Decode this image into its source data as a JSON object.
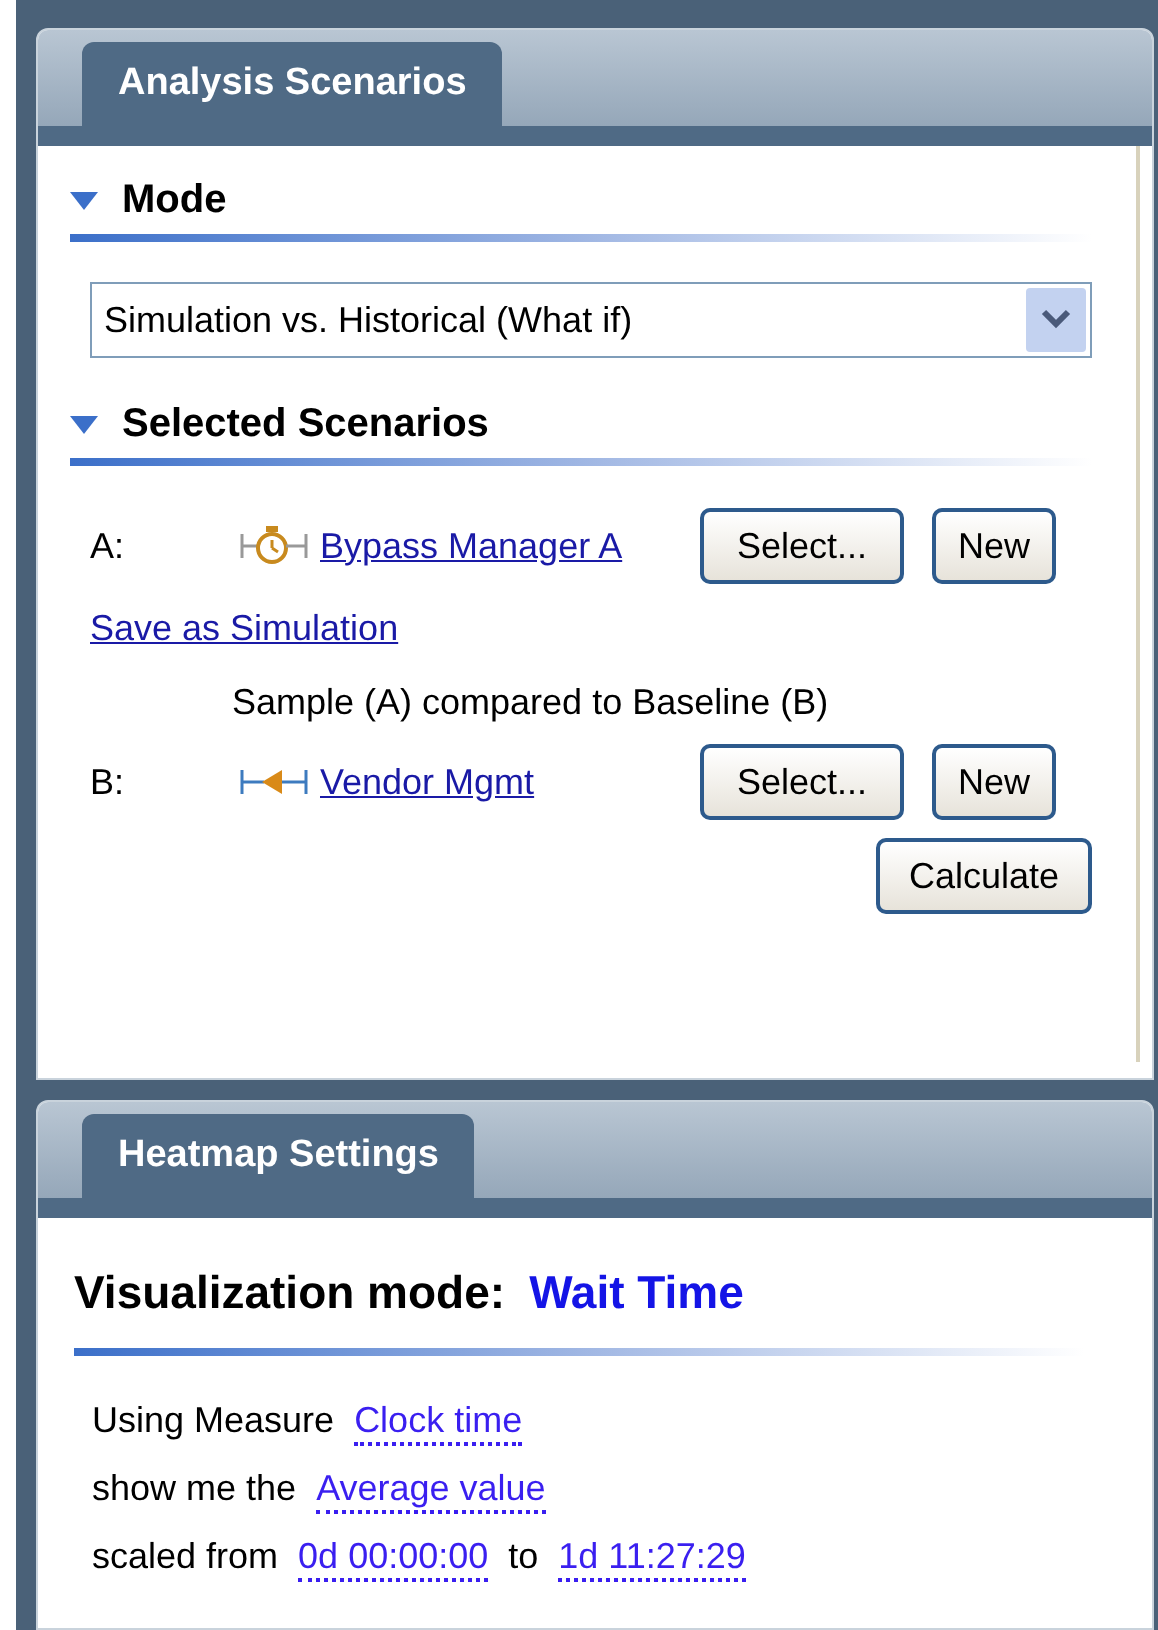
{
  "analysis_panel": {
    "tab": {
      "label": "Analysis Scenarios",
      "selected": true
    },
    "mode_section": {
      "title": "Mode",
      "expanded": true,
      "dropdown": {
        "value": "Simulation vs. Historical (What if)"
      }
    },
    "scenarios_section": {
      "title": "Selected Scenarios",
      "expanded": true,
      "scenarios": [
        {
          "label": "A:",
          "kind": "stopwatch",
          "name": "Bypass Manager A",
          "select_button": "Select...",
          "new_button": "New"
        },
        {
          "label": "B:",
          "kind": "marker",
          "name": "Vendor Mgmt",
          "select_button": "Select...",
          "new_button": "New"
        }
      ],
      "save_link": "Save as Simulation",
      "comparison": "Sample (A) compared to Baseline (B)",
      "calculate_button": "Calculate"
    }
  },
  "heatmap_panel": {
    "tab": {
      "label": "Heatmap Settings",
      "selected": true
    },
    "visualization": {
      "label": "Visualization mode:",
      "value": "Wait Time"
    },
    "settings": [
      {
        "parts": [
          {
            "kind": "text",
            "text": "Using Measure"
          },
          {
            "kind": "link",
            "text": "Clock time"
          }
        ]
      },
      {
        "parts": [
          {
            "kind": "text",
            "text": "show me the"
          },
          {
            "kind": "link",
            "text": "Average value"
          }
        ]
      },
      {
        "parts": [
          {
            "kind": "text",
            "text": "scaled from"
          },
          {
            "kind": "link",
            "text": "0d 00:00:00"
          },
          {
            "kind": "text",
            "text": "to"
          },
          {
            "kind": "link",
            "text": "1d 11:27:29"
          }
        ]
      }
    ]
  }
}
